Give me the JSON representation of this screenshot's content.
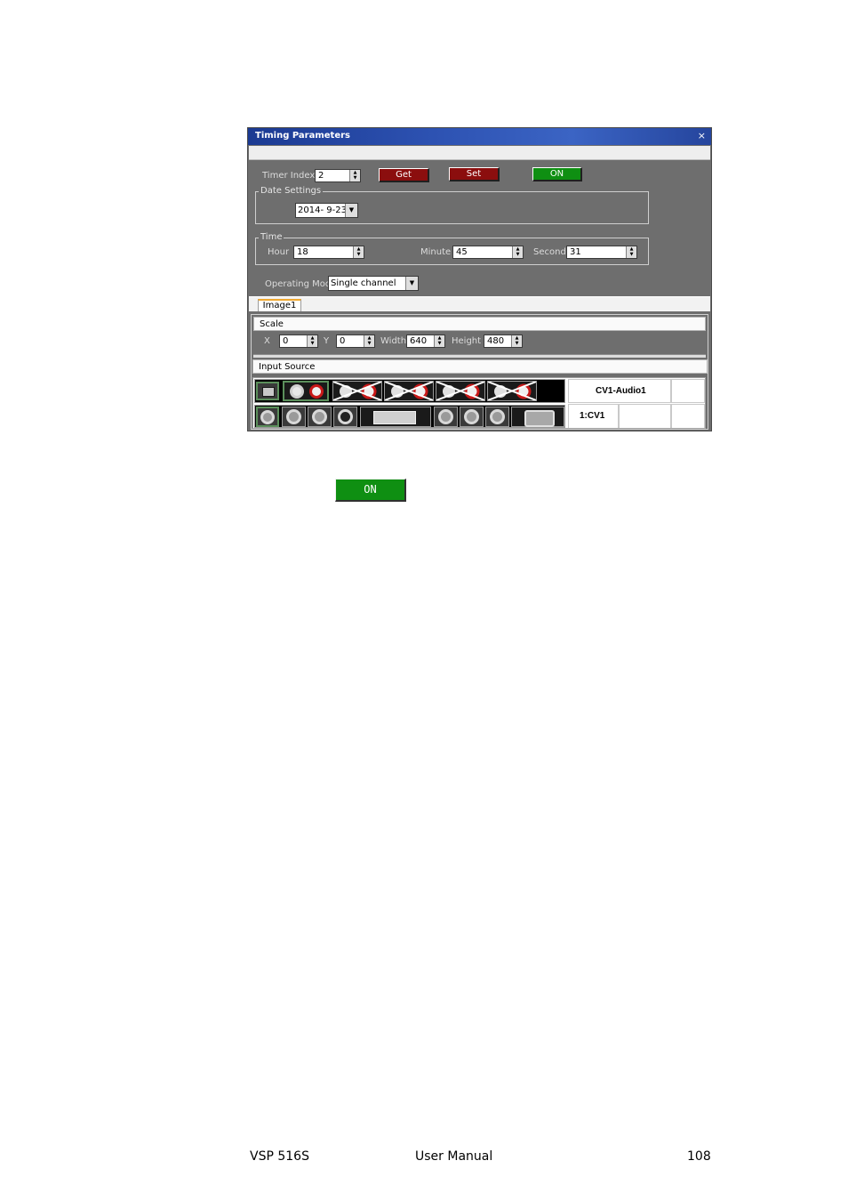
{
  "window": {
    "title": "Timing Parameters",
    "close_glyph": "×"
  },
  "timer": {
    "index_label": "Timer Index",
    "index_value": "2",
    "get_label": "Get",
    "set_label": "Set",
    "on_label": "ON"
  },
  "date": {
    "group_label": "Date Settings",
    "value": "2014- 9-23"
  },
  "time": {
    "group_label": "Time",
    "hour_label": "Hour",
    "hour_value": "18",
    "minute_label": "Minute",
    "minute_value": "45",
    "second_label": "Second",
    "second_value": "31"
  },
  "mode": {
    "label": "Operating Mode",
    "value": "Single channel"
  },
  "tabs": [
    {
      "label": "Image1"
    }
  ],
  "scale": {
    "header": "Scale",
    "x_label": "X",
    "x_value": "0",
    "y_label": "Y",
    "y_value": "0",
    "width_label": "Width",
    "width_value": "640",
    "height_label": "Height",
    "height_value": "480"
  },
  "input_source": {
    "header": "Input Source",
    "audio_selection": "CV1-Audio1",
    "video_selection": "1:CV1"
  },
  "standalone_button": {
    "label": "ON"
  },
  "footer": {
    "product": "VSP 516S",
    "doc": "User Manual",
    "page": "108"
  },
  "colors": {
    "title_bar": "#2d52b2",
    "window_bg": "#6e6e6e",
    "get_set_button": "#8b0e0e",
    "on_button": "#0f8f12",
    "tab_accent": "#f0a830"
  },
  "icons": {
    "close": "close-icon",
    "spin_up": "arrow-up-icon",
    "spin_down": "arrow-down-icon",
    "dropdown": "chevron-down-icon"
  }
}
